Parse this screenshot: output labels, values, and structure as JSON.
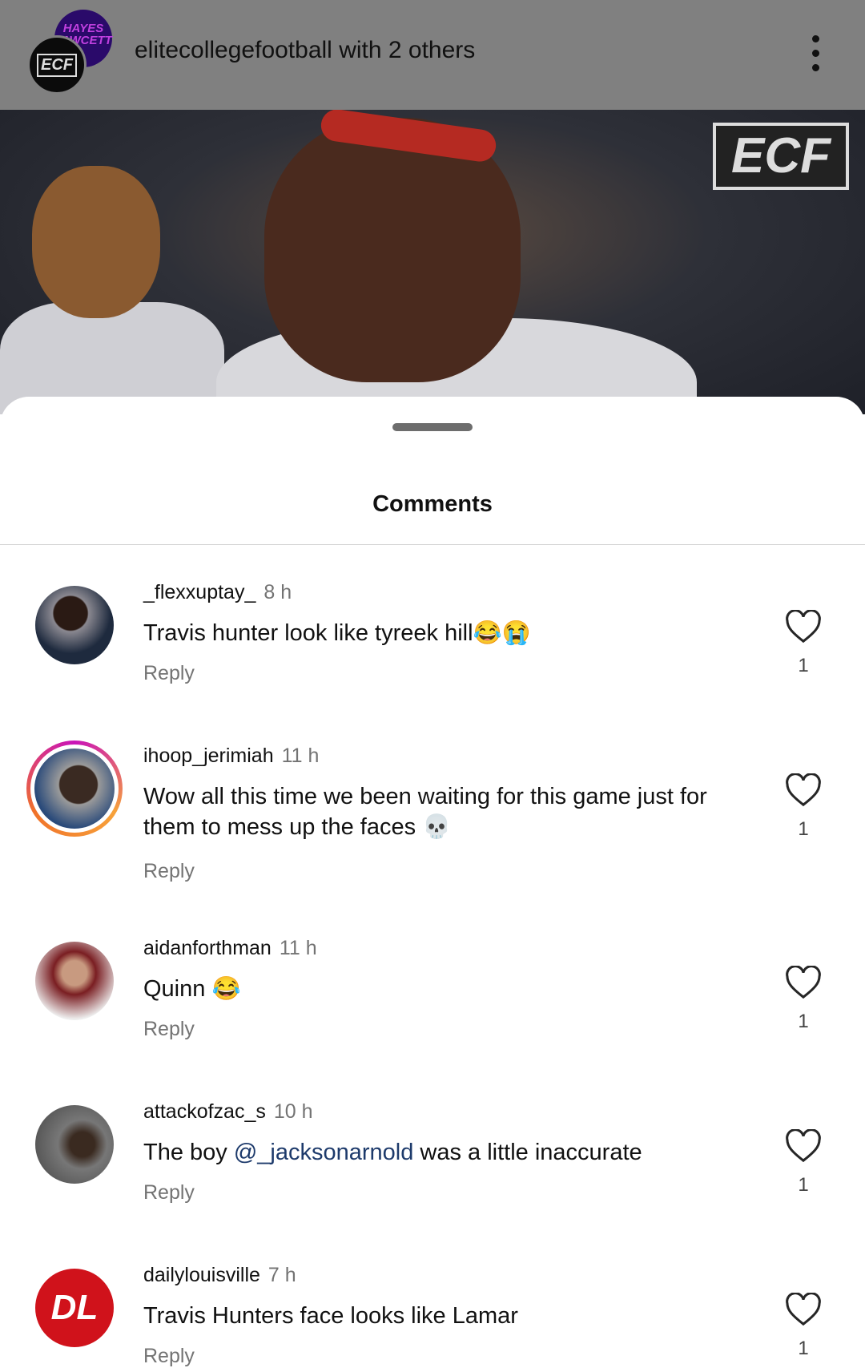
{
  "header": {
    "username": "elitecollegefootball",
    "suffix": "with 2 others",
    "avatar_back_text": "HAYES FAWCETT",
    "avatar_front_text": "ECF",
    "more_icon": "vertical-ellipsis-icon"
  },
  "post": {
    "watermark": "ECF"
  },
  "sheet": {
    "title": "Comments"
  },
  "comments": [
    {
      "username": "_flexxuptay_",
      "time": "8 h",
      "text": "Travis hunter look like tyreek hill😂😭",
      "reply": "Reply",
      "likes": "1"
    },
    {
      "username": "ihoop_jerimiah",
      "time": "11 h",
      "text": "Wow all this time we been waiting for this game just for them to mess up the faces 💀",
      "reply": "Reply",
      "likes": "1",
      "story_ring": true
    },
    {
      "username": "aidanforthman",
      "time": "11 h",
      "text": "Quinn 😂",
      "reply": "Reply",
      "likes": "1"
    },
    {
      "username": "attackofzac_s",
      "time": "10 h",
      "text_before": "The boy ",
      "mention": "@_jacksonarnold",
      "text_after": " was a little inaccurate",
      "reply": "Reply",
      "likes": "1"
    },
    {
      "username": "dailylouisville",
      "time": "7 h",
      "text": "Travis Hunters face looks like Lamar",
      "reply": "Reply",
      "likes": "1",
      "avatar_text": "DL"
    }
  ],
  "colors": {
    "mention": "#1d3a6b",
    "secondary_text": "#737373",
    "dl_red": "#d0121b"
  }
}
